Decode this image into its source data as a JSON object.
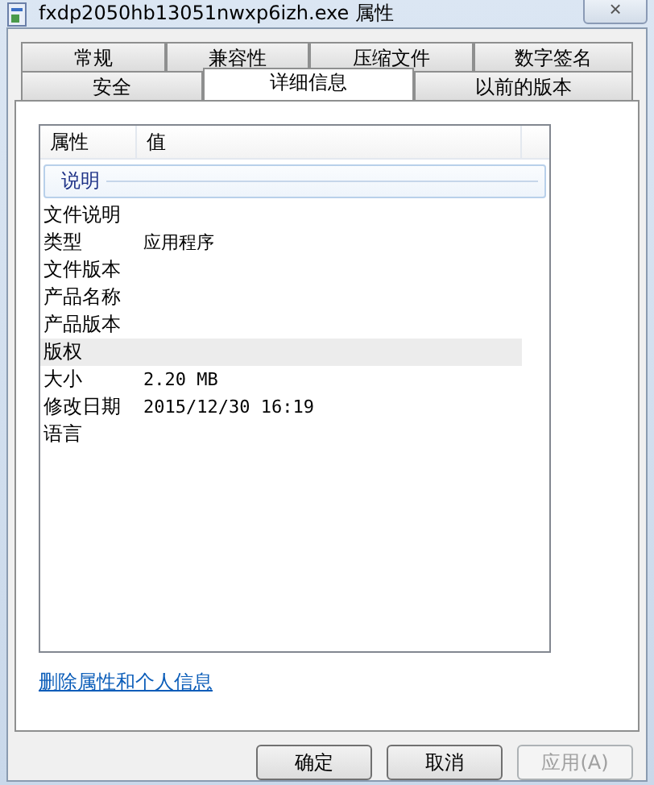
{
  "window": {
    "title": "fxdp2050hb13051nwxp6izh.exe 属性",
    "close": "×"
  },
  "tab_rows": [
    [
      {
        "label": "常规",
        "selected": false
      },
      {
        "label": "兼容性",
        "selected": false
      },
      {
        "label": "压缩文件",
        "selected": false
      },
      {
        "label": "数字签名",
        "selected": false
      }
    ],
    [
      {
        "label": "安全",
        "selected": false
      },
      {
        "label": "详细信息",
        "selected": true
      },
      {
        "label": "以前的版本",
        "selected": false
      }
    ]
  ],
  "table": {
    "columns": [
      "属性",
      "值"
    ],
    "group": "说明",
    "rows": [
      {
        "property": "文件说明",
        "value": "",
        "highlighted": false
      },
      {
        "property": "类型",
        "value": "应用程序",
        "highlighted": false
      },
      {
        "property": "文件版本",
        "value": "",
        "highlighted": false
      },
      {
        "property": "产品名称",
        "value": "",
        "highlighted": false
      },
      {
        "property": "产品版本",
        "value": "",
        "highlighted": false
      },
      {
        "property": "版权",
        "value": "",
        "highlighted": true
      },
      {
        "property": "大小",
        "value": "2.20 MB",
        "highlighted": false
      },
      {
        "property": "修改日期",
        "value": "2015/12/30 16:19",
        "highlighted": false
      },
      {
        "property": "语言",
        "value": "",
        "highlighted": false
      }
    ]
  },
  "link": "删除属性和个人信息",
  "buttons": [
    {
      "label": "确定",
      "disabled": false
    },
    {
      "label": "取消",
      "disabled": false
    },
    {
      "label": "应用(A)",
      "disabled": true
    }
  ]
}
